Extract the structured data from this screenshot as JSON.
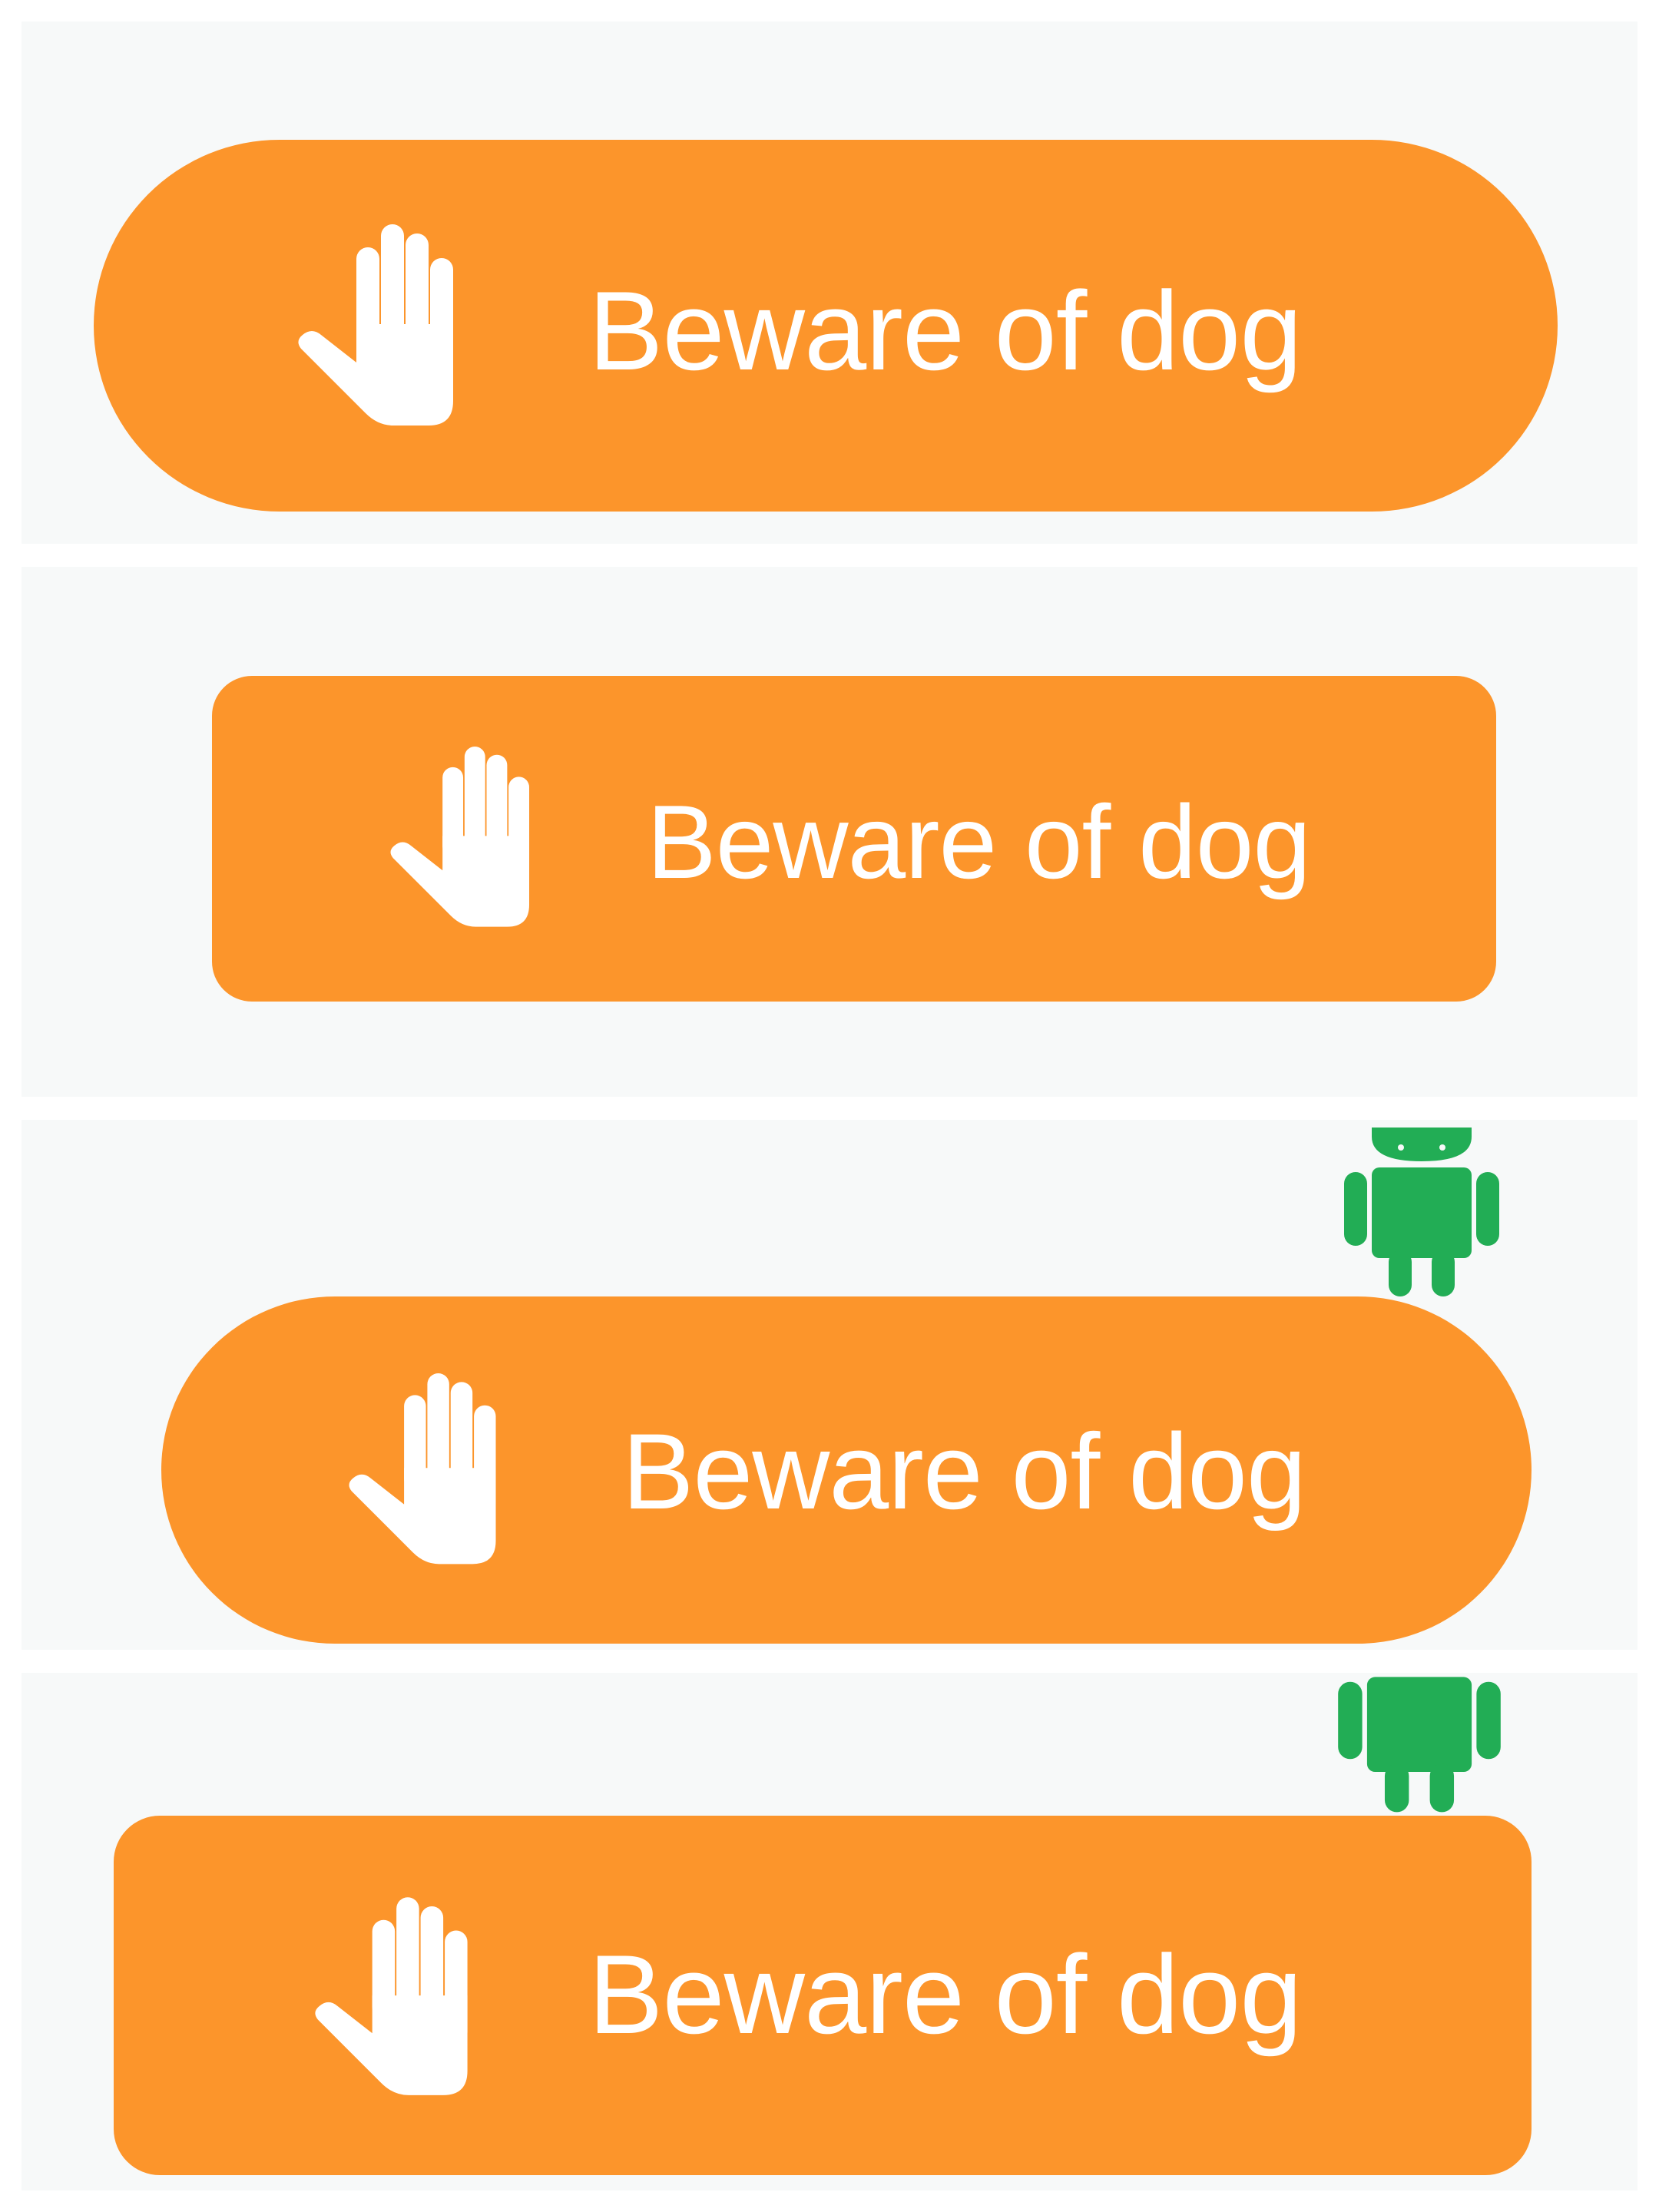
{
  "colors": {
    "background": "#ffffff",
    "panel": "#f7f9f9",
    "button": "#fc952b",
    "button_text": "#ffffff",
    "android": "#22ad55"
  },
  "icons": {
    "button_icon": "raised-hand-icon",
    "badge_icon": "android-robot-icon"
  },
  "variants": [
    {
      "label": "Beware of dog"
    },
    {
      "label": "Beware of dog"
    },
    {
      "label": "Beware of dog"
    },
    {
      "label": "Beware of dog"
    }
  ]
}
